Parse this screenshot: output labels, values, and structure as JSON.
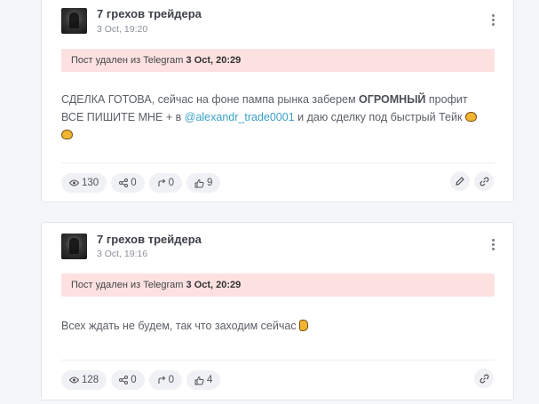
{
  "posts": [
    {
      "channel": "7 грехов трейдера",
      "time": "3 Oct, 19:20",
      "deleted_prefix": "Пост удален из Telegram",
      "deleted_time": "3 Oct, 20:29",
      "text": {
        "line1_start": "СДЕЛКА ГОТОВА, сейчас на фоне пампа рынка заберем ",
        "line1_bold": "ОГРОМНЫЙ",
        "line1_end": " профит",
        "line2_start": "ВСЕ ПИШИТЕ МНЕ + в ",
        "mention": "@alexandr_trade0001",
        "line2_end": " и даю сделку под быстрый Тейк"
      },
      "stats": {
        "views": "130",
        "shares": "0",
        "forwards": "0",
        "likes": "9"
      }
    },
    {
      "channel": "7 грехов трейдера",
      "time": "3 Oct, 19:16",
      "deleted_prefix": "Пост удален из Telegram",
      "deleted_time": "3 Oct, 20:29",
      "text": {
        "line1": "Всех ждать не будем, так что заходим сейчас"
      },
      "stats": {
        "views": "128",
        "shares": "0",
        "forwards": "0",
        "likes": "4"
      }
    }
  ],
  "icons": {
    "views": "eye-icon",
    "shares": "share-icon",
    "forwards": "forward-icon",
    "likes": "thumbs-up-icon",
    "edit": "pencil-icon",
    "link": "link-icon",
    "menu": "more-vertical-icon"
  },
  "colors": {
    "deleted_banner": "#fde1e1",
    "mention": "#3aa0c8",
    "chip_bg": "#f0f1f4"
  }
}
